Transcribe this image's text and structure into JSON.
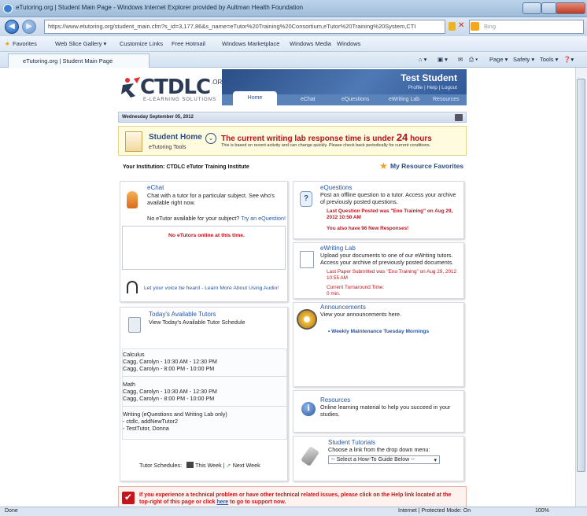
{
  "browser": {
    "title": "eTutoring.org | Student Main Page - Windows Internet Explorer provided by Aultman Health Foundation",
    "url": "https://www.etutoring.org/student_main.cfm?s_id=3,177,86&s_name=eTutor%20Training%20Consortium,eTutor%20Training%20System,CTI",
    "url_bold": "etutoring.org",
    "search_placeholder": "Bing",
    "favorites": [
      "Favorites",
      "Web Slice Gallery ▾",
      "Customize Links",
      "Free Hotmail",
      "Windows Marketplace",
      "Windows Media",
      "Windows"
    ],
    "tab": "eTutoring.org | Student Main Page",
    "commands": [
      "Page ▾",
      "Safety ▾",
      "Tools ▾"
    ],
    "status_left": "Done",
    "status_mode": "Internet | Protected Mode: On",
    "zoom": "100%"
  },
  "header": {
    "logo": "CTDLC",
    "logo_org": ".ORG",
    "logo_sub": "E-LEARNING SOLUTIONS",
    "user": "Test Student",
    "user_links": "Profile | Help | Logout",
    "tabs": [
      "Home",
      "eChat",
      "eQuestions",
      "eWriting Lab",
      "Resources"
    ]
  },
  "date": "Wednesday September 05, 2012",
  "alert": {
    "title": "Student Home",
    "subtitle": "eTutoring Tools",
    "response_prefix": "The current writing lab response time is under",
    "response_num": "24",
    "response_suffix": "hours",
    "response_sub": "This is based on recent activity and can change quickly. Please check back periodically for current conditions."
  },
  "institution": "Your Institution: CTDLC eTutor Training Institute",
  "favorites_link": "My Resource Favorites",
  "echat": {
    "title": "eChat",
    "desc": "Chat with a tutor for a particular subject. See who's available right now.",
    "no_tutor": "No eTutor available for your subject?",
    "try_link": "Try an eQuestion!",
    "online": "No eTutors online at this time.",
    "audio": "Let your voice be heard - Learn More About Using Audio!"
  },
  "tutors": {
    "title": "Today's Available Tutors",
    "desc": "View Today's Available Tutor Schedule",
    "groups": [
      {
        "subject": "Calculus",
        "lines": [
          "Cagg, Carolyn - 10:30 AM - 12:30 PM",
          "Cagg, Carolyn - 8:00 PM - 10:00 PM"
        ]
      },
      {
        "subject": "Math",
        "lines": [
          "Cagg, Carolyn - 10:30 AM - 12:30 PM",
          "Cagg, Carolyn - 8:00 PM - 10:00 PM"
        ]
      },
      {
        "subject": "Writing (eQuestions and Writing Lab only)",
        "lines": [
          "- ctdlc, addNewTutor2",
          "- TestTutor, Donna"
        ]
      }
    ],
    "schedules_label": "Tutor Schedules:",
    "this_week": "This Week",
    "next_week": "Next Week"
  },
  "equestions": {
    "title": "eQuestions",
    "desc": "Post an offline question to a tutor. Access your archive of previously posted questions.",
    "last_posted": "Last Question Posted was \"Eno Training\" on Aug 29, 2012 10:50 AM",
    "new_responses": "You also have 96 New Responses!"
  },
  "ewriting": {
    "title": "eWriting Lab",
    "desc": "Upload your documents to one of our eWriting tutors. Access your archive of previously posted documents.",
    "last_paper": "Last Paper Submitted was \"Eno Training\" on Aug 29, 2012 10:55 AM",
    "turnaround_label": "Current Turnaround Time:",
    "turnaround_value": "0 min."
  },
  "announcements": {
    "title": "Announcements",
    "desc": "View your announcements here.",
    "item": "Weekly Maintenance Tuesday Mornings"
  },
  "resources": {
    "title": "Resources",
    "desc": "Online learning material to help you succeed in your studies."
  },
  "tutorials": {
    "title": "Student Tutorials",
    "desc": "Choose a link from the drop down menu:",
    "select": "-- Select a How-To Guide Below --"
  },
  "support": {
    "text_a": "If you experience a technical problem or have other technical related issues, please click on the Help link located at the top-right of this page or click",
    "here": "here",
    "text_b": "to go to support now."
  }
}
